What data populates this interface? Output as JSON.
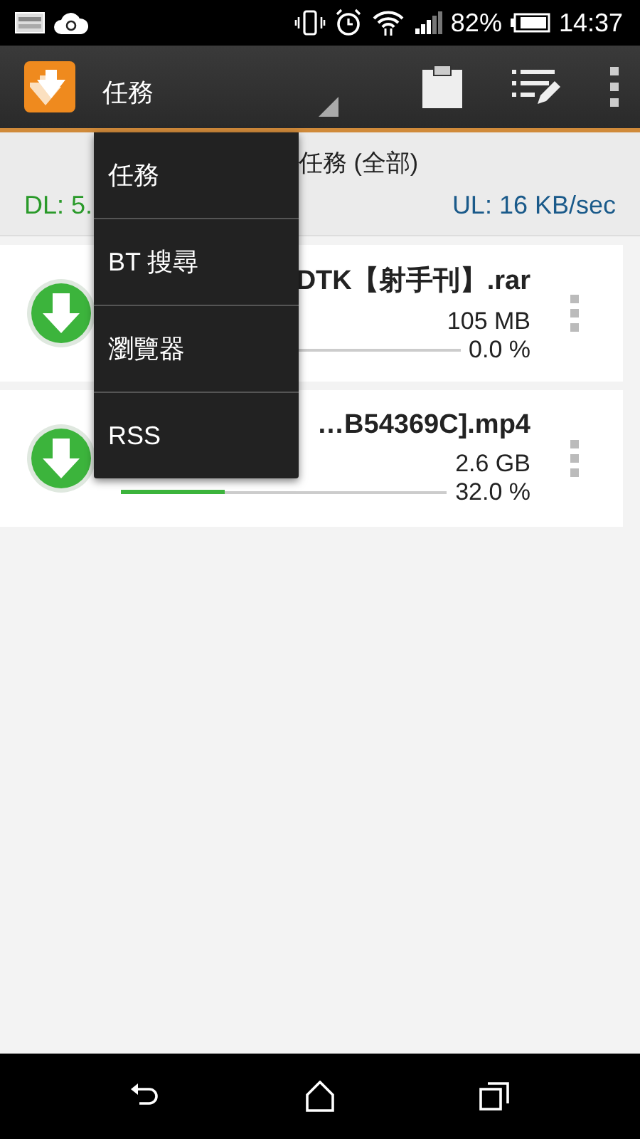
{
  "status_bar": {
    "battery": "82%",
    "time": "14:37"
  },
  "action_bar": {
    "title": "任務"
  },
  "summary": {
    "heading": "任務 (全部)",
    "download": "DL: 5.",
    "upload": "UL: 16 KB/sec"
  },
  "tasks": [
    {
      "name": "DTK【射手刊】.rar",
      "size": "105 MB",
      "percent": "0.0 %"
    },
    {
      "name": "…B54369C].mp4",
      "size": "2.6 GB",
      "percent": "32.0 %",
      "level": 0.32
    }
  ],
  "menu": {
    "items": [
      {
        "label": "任務"
      },
      {
        "label": "BT 搜尋"
      },
      {
        "label": "瀏覽器"
      },
      {
        "label": "RSS"
      }
    ]
  }
}
